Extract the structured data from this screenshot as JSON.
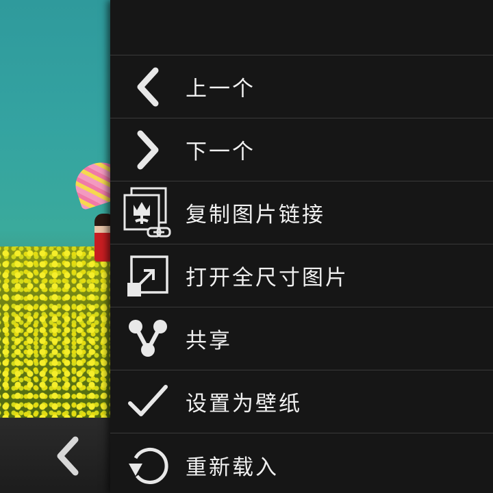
{
  "menu": {
    "items": [
      {
        "label": "上一个",
        "icon": "chevron-left-icon"
      },
      {
        "label": "下一个",
        "icon": "chevron-right-icon"
      },
      {
        "label": "复制图片链接",
        "icon": "copy-image-link-icon"
      },
      {
        "label": "打开全尺寸图片",
        "icon": "expand-image-icon"
      },
      {
        "label": "共享",
        "icon": "share-icon"
      },
      {
        "label": "设置为壁纸",
        "icon": "checkmark-icon"
      },
      {
        "label": "重新载入",
        "icon": "reload-icon"
      }
    ]
  },
  "navigation": {
    "back_icon": "back-chevron-icon"
  },
  "colors": {
    "menu_background": "#161616",
    "divider": "#3a3a3a",
    "text": "#f0f0f0",
    "icon": "#e8e8e8"
  }
}
